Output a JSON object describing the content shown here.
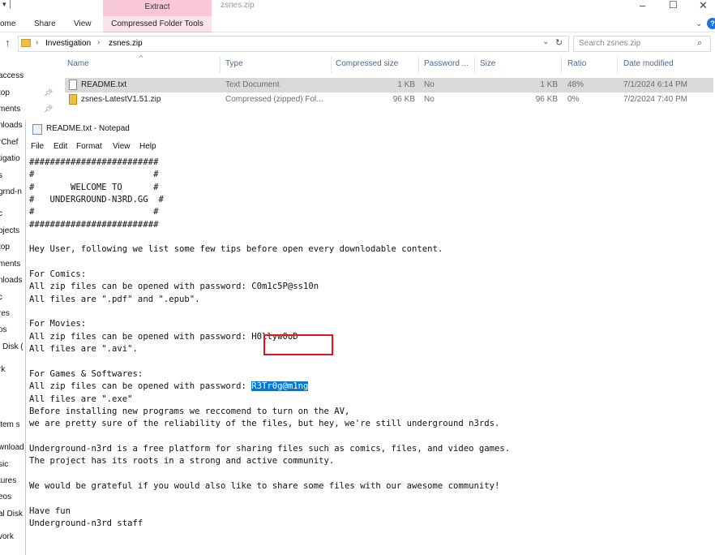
{
  "ribbon": {
    "tabs": [
      "ome",
      "Share",
      "View"
    ],
    "extract_label": "Extract",
    "compressed_tools_label": "Compressed Folder Tools",
    "window_title": "zsnes.zip",
    "accent_color": "#f9c8d6"
  },
  "address": {
    "crumbs": [
      "Investigation",
      "zsnes.zip"
    ],
    "search_placeholder": "Search zsnes.zip"
  },
  "nav_pane": {
    "items": [
      "access",
      "top",
      "ments",
      "nloads",
      "rChef",
      "tigatio",
      "s",
      "grnd-n",
      "c",
      "bjects",
      "top",
      "ments",
      "nloads",
      "c",
      "res",
      "os",
      "l Disk (",
      "rk",
      "item s",
      "wnload",
      "sic",
      "tures",
      "eos",
      "al Disk",
      "vork"
    ]
  },
  "columns": [
    "Name",
    "Type",
    "Compressed size",
    "Password ...",
    "Size",
    "Ratio",
    "Date modified"
  ],
  "files": [
    {
      "name": "README.txt",
      "type": "Text Document",
      "compressed_size": "1 KB",
      "password": "No",
      "size": "1 KB",
      "ratio": "48%",
      "date": "7/1/2024 6:14 PM"
    },
    {
      "name": "zsnes-LatestV1.51.zip",
      "type": "Compressed (zipped) Fol...",
      "compressed_size": "96 KB",
      "password": "No",
      "size": "96 KB",
      "ratio": "0%",
      "date": "7/2/2024 7:40 PM"
    }
  ],
  "notepad": {
    "title": "README.txt - Notepad",
    "menu": [
      "File",
      "Edit",
      "Format",
      "View",
      "Help"
    ],
    "lines": [
      "#########################",
      "#                       #",
      "#       WELCOME TO      #",
      "#   UNDERGROUND-N3RD.GG  #",
      "#                       #",
      "#########################",
      "",
      "Hey User, following we list some few tips before open every downlodable content.",
      "",
      "For Comics:",
      "All zip files can be opened with password: C0m1c5P@ss10n",
      "All files are \".pdf\" and \".epub\".",
      "",
      "For Movies:",
      "All zip files can be opened with password: H0llyw0oD",
      "All files are \".avi\".",
      "",
      "For Games & Softwares:"
    ],
    "pw_prefix": "All zip files can be opened with password: ",
    "pw_selected": "R3Tr0g@m1ng",
    "lines_after": [
      "All files are \".exe\"",
      "Before installing new programs we reccomend to turn on the AV,",
      "we are pretty sure of the reliability of the files, but hey, we're still underground n3rds.",
      "",
      "Underground-n3rd is a free platform for sharing files such as comics, files, and video games.",
      "The project has its roots in a strong and active community.",
      "",
      "We would be grateful if you would also like to share some files with our awesome community!",
      "",
      "Have fun",
      "Underground-n3rd staff"
    ],
    "highlight_color": "#0078d7",
    "annotation_color": "#e0161b"
  }
}
